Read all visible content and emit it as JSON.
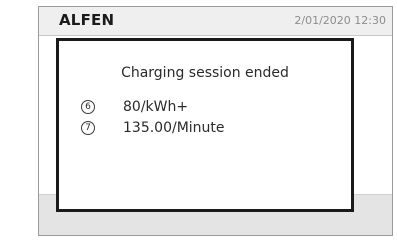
{
  "header": {
    "brand": "ALFEN",
    "datetime": "2/01/2020 12:30"
  },
  "dialog": {
    "title": "Charging session ended",
    "items": [
      {
        "number": "6",
        "value": "80/kWh+"
      },
      {
        "number": "7",
        "value": "135.00/Minute"
      }
    ]
  }
}
